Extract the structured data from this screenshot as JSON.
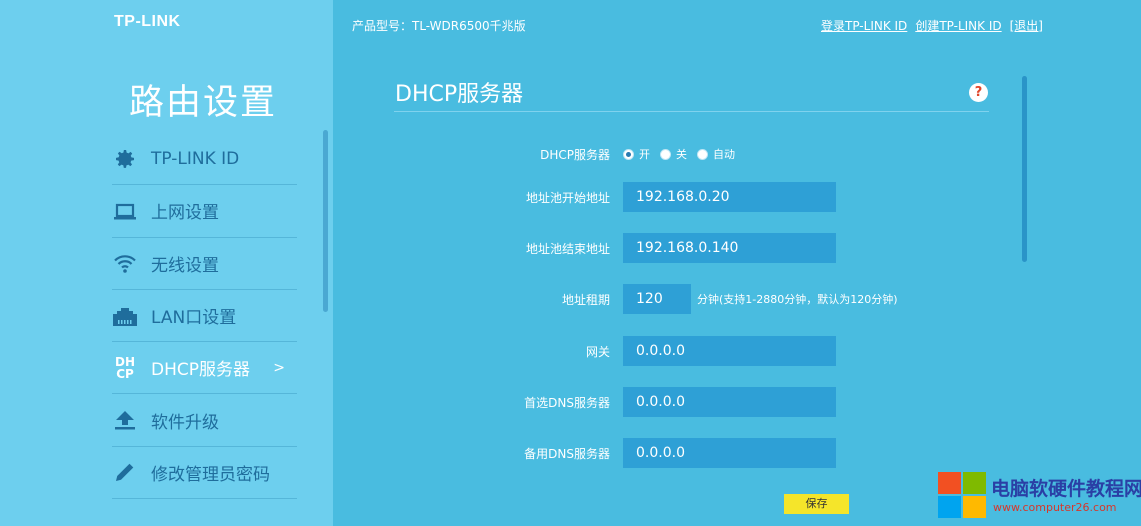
{
  "brand": {
    "logo": "TP-LINK"
  },
  "header": {
    "model": "产品型号：TL-WDR6500千兆版",
    "links": [
      "登录TP-LINK ID",
      "创建TP-LINK ID",
      "[退出]"
    ]
  },
  "sidebar": {
    "title": "路由设置",
    "items": [
      {
        "label": "TP-LINK ID",
        "icon": "gear-icon"
      },
      {
        "label": "上网设置",
        "icon": "laptop-icon"
      },
      {
        "label": "无线设置",
        "icon": "wifi-icon"
      },
      {
        "label": "LAN口设置",
        "icon": "lan-port-icon"
      },
      {
        "label": "DHCP服务器",
        "icon": "dhcp-icon",
        "icon_text_top": "DH",
        "icon_text_bottom": "CP",
        "active": true,
        "arrow": ">"
      },
      {
        "label": "软件升级",
        "icon": "upload-icon"
      },
      {
        "label": "修改管理员密码",
        "icon": "pencil-icon"
      }
    ]
  },
  "panel": {
    "title": "DHCP服务器",
    "help": "?",
    "dhcp_server": {
      "label": "DHCP服务器",
      "options": [
        "开",
        "关",
        "自动"
      ],
      "selected": "开"
    },
    "pool_start": {
      "label": "地址池开始地址",
      "value": "192.168.0.20"
    },
    "pool_end": {
      "label": "地址池结束地址",
      "value": "192.168.0.140"
    },
    "lease": {
      "label": "地址租期",
      "value": "120",
      "hint": "分钟(支持1-2880分钟，默认为120分钟)"
    },
    "gateway": {
      "label": "网关",
      "value": "0.0.0.0"
    },
    "dns_primary": {
      "label": "首选DNS服务器",
      "value": "0.0.0.0"
    },
    "dns_secondary": {
      "label": "备用DNS服务器",
      "value": "0.0.0.0"
    },
    "save_label": "保存"
  },
  "watermark": {
    "title": "电脑软硬件教程网",
    "url": "www.computer26.com",
    "colors": [
      "#f25022",
      "#7fba00",
      "#00a4ef",
      "#ffb900"
    ]
  },
  "colors": {
    "main_bg": "#49bce0",
    "sidebar_bg": "#6dcfee",
    "input_bg": "#2ea0d6",
    "save_button": "#f5e52a",
    "help_icon": "#e0462a"
  }
}
